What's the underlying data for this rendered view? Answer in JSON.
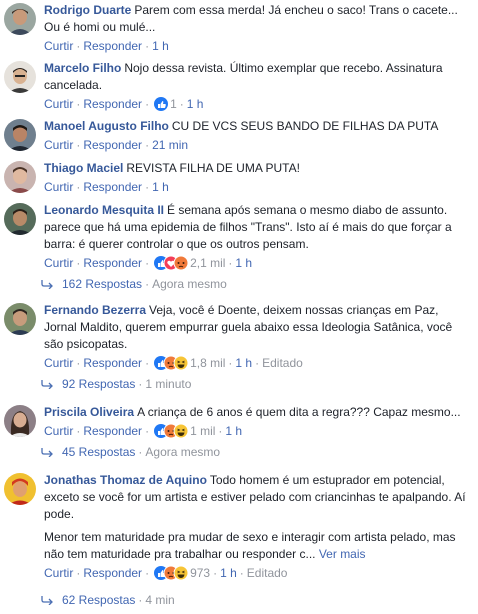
{
  "labels": {
    "like": "Curtir",
    "reply": "Responder",
    "sep": "·",
    "edited": "Editado"
  },
  "comments": [
    {
      "name": "Rodrigo Duarte",
      "text": "Parem com essa merda! Já encheu o saco! Trans o cacete... Ou é homi ou mulé...",
      "time": "1 h",
      "reactions": "",
      "reaction_icons": [],
      "skin": "#c89a7a",
      "hair": "#3b2a20",
      "bg": "#9aa6a0"
    },
    {
      "name": "Marcelo Filho",
      "text": "Nojo dessa revista. Último exemplar que recebo. Assinatura cancelada.",
      "time": "1 h",
      "reactions": "1",
      "reaction_icons": [
        "like-icon"
      ],
      "skin": "#d9b291",
      "hair": "#2a2420",
      "bg": "#e6e2dc"
    },
    {
      "name": "Manoel Augusto Filho",
      "text": "CU DE VCS SEUS BANDO DE FILHAS DA PUTA",
      "time": "21 min",
      "reactions": "",
      "reaction_icons": [],
      "skin": "#b98466",
      "hair": "#1c1612",
      "bg": "#6f7f8e"
    },
    {
      "name": "Thiago Maciel",
      "text": "REVISTA FILHA DE UMA PUTA!",
      "time": "1 h",
      "reactions": "",
      "reaction_icons": [],
      "skin": "#e0b9a0",
      "hair": "#4a3326",
      "bg": "#c9b4b0"
    },
    {
      "name": "Leonardo Mesquita II",
      "text": "É semana após semana o mesmo diabo de assunto. parece que há uma epidemia de filhos \"Trans\". Isto aí é mais do que forçar a barra: é querer controlar o que os outros pensam.",
      "time": "1 h",
      "reactions": "2,1 mil",
      "reaction_icons": [
        "like-icon",
        "love-icon",
        "angry-icon"
      ],
      "skin": "#b88a68",
      "hair": "#2a1f18",
      "bg": "#556b5a",
      "replies": {
        "count": "162 Respostas",
        "time": "Agora mesmo"
      }
    },
    {
      "name": "Fernando Bezerra",
      "text": "Veja, você é Doente, deixem nossas crianças em Paz, Jornal Maldito, querem empurrar guela abaixo essa Ideologia Satânica, você são psicopatas.",
      "time": "1 h",
      "edited": true,
      "reactions": "1,8 mil",
      "reaction_icons": [
        "like-icon",
        "angry-icon",
        "haha-icon"
      ],
      "skin": "#c79c7c",
      "hair": "#2e2620",
      "bg": "#7a8c6a",
      "replies": {
        "count": "92 Respostas",
        "time": "1 minuto"
      }
    },
    {
      "name": "Priscila Oliveira",
      "text": "A criança de 6 anos é quem dita a regra??? Capaz mesmo...",
      "time": "1 h",
      "reactions": "1 mil",
      "reaction_icons": [
        "like-icon",
        "angry-icon",
        "haha-icon"
      ],
      "skin": "#d8ad92",
      "hair": "#3a2a22",
      "bg": "#8c7f86",
      "replies": {
        "count": "45 Respostas",
        "time": "Agora mesmo"
      }
    },
    {
      "name": "Jonathas Thomaz de Aquino",
      "text": "Todo homem é um estuprador em potencial, exceto se você for um artista e estiver pelado com criancinhas te apalpando. Aí pode.",
      "text2": "Menor tem maturidade pra mudar de sexo e interagir com artista pelado, mas não tem maturidade pra trabalhar ou responder c...",
      "more": "Ver mais",
      "time": "1 h",
      "edited": true,
      "reactions": "973",
      "reaction_icons": [
        "like-icon",
        "angry-icon",
        "haha-icon"
      ],
      "skin": "#e0a070",
      "hair": "#d23a20",
      "bg": "#f0c030",
      "replies": {
        "count": "62 Respostas",
        "time": "4 min"
      }
    }
  ]
}
